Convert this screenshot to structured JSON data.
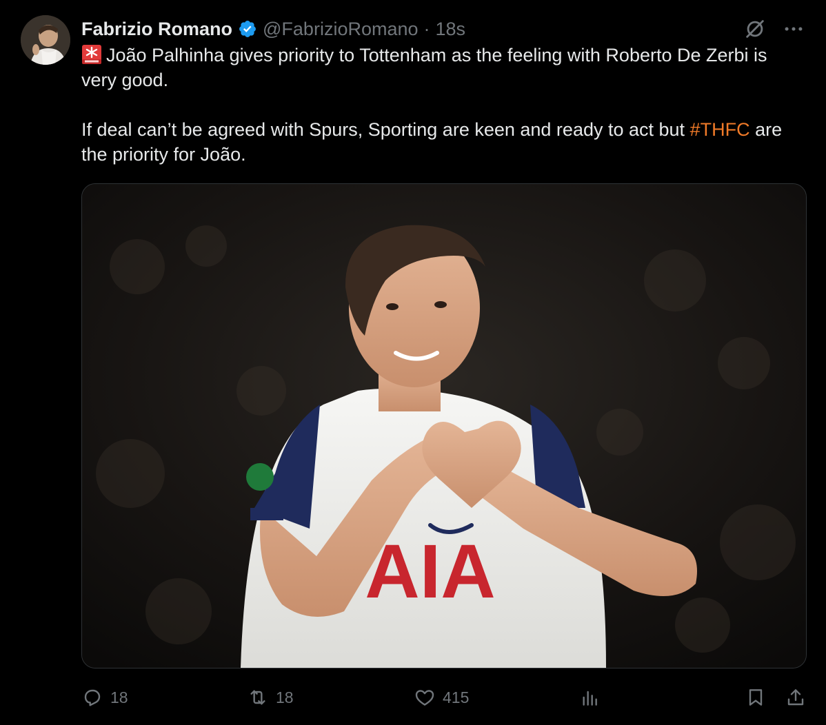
{
  "tweet": {
    "author_name": "Fabrizio Romano",
    "handle": "@FabrizioRomano",
    "separator": "·",
    "time": "18s",
    "text_line1": "João Palhinha gives priority to Tottenham as the feeling with Roberto De Zerbi is very good.",
    "text_para2_before": "If deal can’t be agreed with Spurs, Sporting are keen and ready to act but ",
    "hashtag": "#THFC",
    "text_para2_after": " are the priority for João.",
    "media_shirt_text": "AIA"
  },
  "metrics": {
    "replies": "18",
    "reposts": "18",
    "likes": "415"
  },
  "icons": {
    "verified": "verified-badge-icon",
    "grok": "grok-icon",
    "more": "more-icon",
    "siren": "rotating-light-emoji-icon",
    "reply": "reply-icon",
    "repost": "repost-icon",
    "like": "heart-icon",
    "views": "views-icon",
    "bookmark": "bookmark-icon",
    "share": "share-icon"
  },
  "colors": {
    "background": "#000000",
    "text": "#e7e9ea",
    "secondary": "#71767b",
    "hashtag": "#f07a28",
    "verified": "#1d9bf0"
  }
}
